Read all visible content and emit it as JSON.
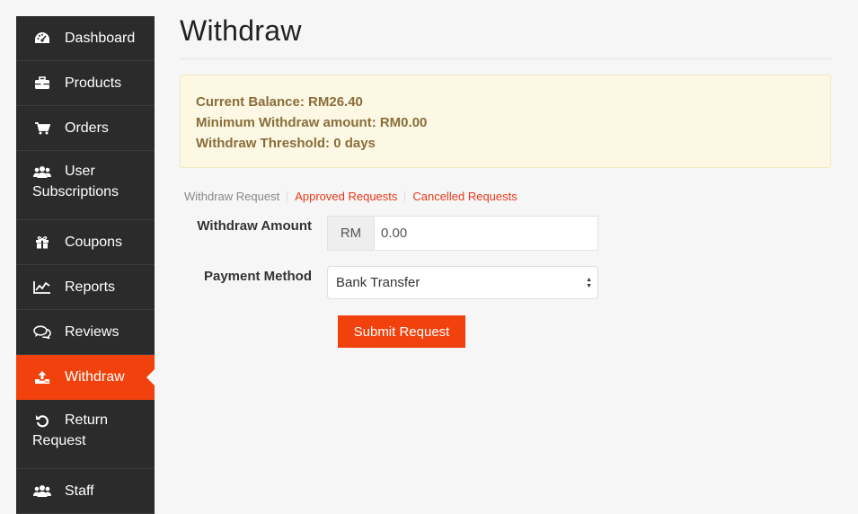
{
  "sidebar": {
    "items": [
      {
        "label": "Dashboard",
        "icon": "dashboard-icon"
      },
      {
        "label": "Products",
        "icon": "briefcase-icon"
      },
      {
        "label": "Orders",
        "icon": "cart-icon"
      },
      {
        "label_line1": "User",
        "label_line2": "Subscriptions",
        "icon": "users-icon"
      },
      {
        "label": "Coupons",
        "icon": "gift-icon"
      },
      {
        "label": "Reports",
        "icon": "line-chart-icon"
      },
      {
        "label": "Reviews",
        "icon": "comments-icon"
      },
      {
        "label": "Withdraw",
        "icon": "upload-icon",
        "active": true
      },
      {
        "label_line1": "Return",
        "label_line2": "Request",
        "icon": "undo-icon"
      },
      {
        "label": "Staff",
        "icon": "users-icon"
      }
    ]
  },
  "page": {
    "title": "Withdraw"
  },
  "balance": {
    "current": "Current Balance: RM26.40",
    "minimum": "Minimum Withdraw amount: RM0.00",
    "threshold": "Withdraw Threshold: 0 days"
  },
  "tabs": {
    "withdraw_request": "Withdraw Request",
    "approved": "Approved Requests",
    "cancelled": "Cancelled Requests"
  },
  "form": {
    "amount_label": "Withdraw Amount",
    "currency": "RM",
    "amount_value": "0.00",
    "payment_label": "Payment Method",
    "payment_value": "Bank Transfer",
    "submit_label": "Submit Request"
  },
  "colors": {
    "accent": "#f1420e",
    "sidebar_bg": "#2b2b2b",
    "alert_bg": "#fcf8e3",
    "alert_text": "#8a6d3b"
  }
}
